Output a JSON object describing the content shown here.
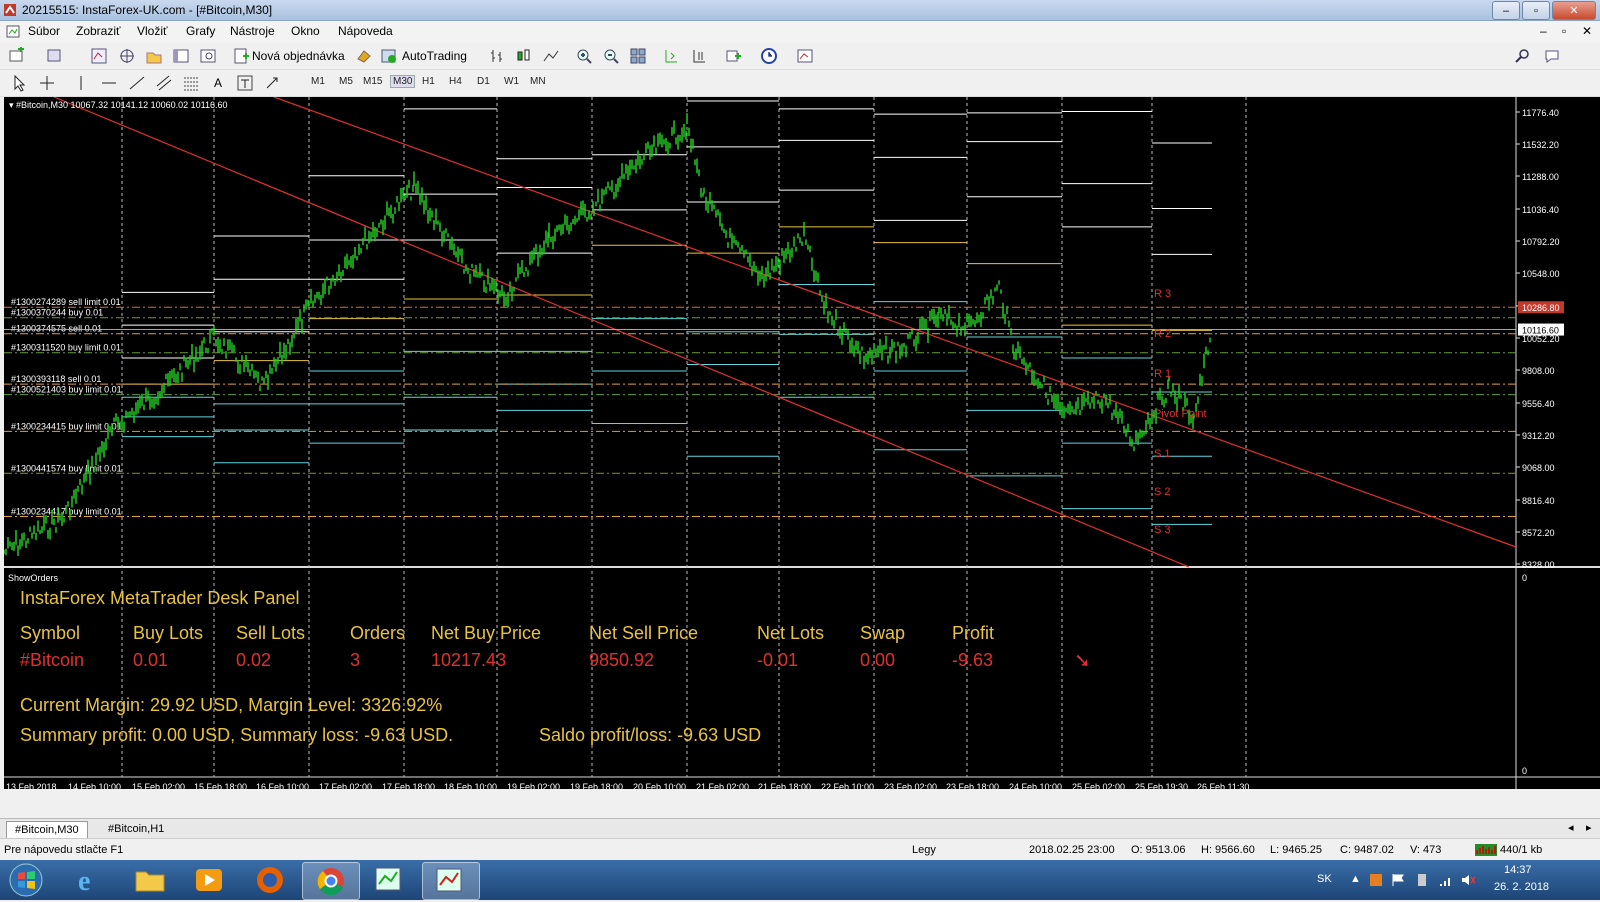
{
  "window": {
    "title": "20215515: InstaForex-UK.com - [#Bitcoin,M30]",
    "controls": [
      "–",
      "▫",
      "✕"
    ]
  },
  "menu": [
    "Súbor",
    "Zobraziť",
    "Vložiť",
    "Grafy",
    "Nástroje",
    "Okno",
    "Nápoveda"
  ],
  "toolbar": {
    "new_order_label": "Nová objednávka",
    "autotrading_label": "AutoTrading",
    "timeframes": [
      "M1",
      "M5",
      "M15",
      "M30",
      "H1",
      "H4",
      "D1",
      "W1",
      "MN"
    ],
    "active_timeframe": "M30"
  },
  "chart": {
    "header": "#Bitcoin,M30  10067.32 10141.12 10060.02 10116.60",
    "price_axis": [
      "11776.40",
      "11532.20",
      "11288.00",
      "11036.40",
      "10792.20",
      "10548.00",
      "10296.80",
      "10052.20",
      "9808.00",
      "9556.40",
      "9312.20",
      "9068.00",
      "8816.40",
      "8572.20",
      "8328.00"
    ],
    "current_price": "10116.60",
    "order_price": "10286.80",
    "orders": [
      {
        "label": "#1300274289 sell limit 0.01",
        "price": 10286.8
      },
      {
        "label": "#1300370244 buy 0.01",
        "price": 10207
      },
      {
        "label": "#1300374575 sell 0.01",
        "price": 10085
      },
      {
        "label": "#1300311520 buy limit 0.01",
        "price": 9940
      },
      {
        "label": "#1300393118 sell 0.01",
        "price": 9700
      },
      {
        "label": "#1300521403 buy limit 0.01",
        "price": 9620
      },
      {
        "label": "#1300234415 buy limit 0.01",
        "price": 9340
      },
      {
        "label": "#1300441574 buy limit 0.01",
        "price": 9020
      },
      {
        "label": "#1300234417 buy limit 0.01",
        "price": 8690
      }
    ],
    "pivot_labels": [
      "R 3",
      "R 2",
      "R 1",
      "Pivot Point",
      "S 1",
      "S 2",
      "S 3"
    ],
    "time_axis": [
      "13 Feb 2018",
      "14 Feb 10:00",
      "15 Feb 02:00",
      "15 Feb 18:00",
      "16 Feb 10:00",
      "17 Feb 02:00",
      "17 Feb 18:00",
      "18 Feb 10:00",
      "19 Feb 02:00",
      "19 Feb 18:00",
      "20 Feb 10:00",
      "21 Feb 02:00",
      "21 Feb 18:00",
      "22 Feb 10:00",
      "23 Feb 02:00",
      "23 Feb 18:00",
      "24 Feb 10:00",
      "25 Feb 02:00",
      "25 Feb 19:30",
      "26 Feb 11:30"
    ],
    "subwindow_label": "ShowOrders",
    "subwindow_axis": [
      "0",
      "0"
    ]
  },
  "panel": {
    "title": "InstaForex MetaTrader Desk Panel",
    "headers": [
      "Symbol",
      "Buy Lots",
      "Sell Lots",
      "Orders",
      "Net Buy Price",
      "Net Sell Price",
      "Net Lots",
      "Swap",
      "Profit"
    ],
    "row": [
      "#Bitcoin",
      "0.01",
      "0.02",
      "3",
      "10217.43",
      "9850.92",
      "-0.01",
      "0.00",
      "-9.63"
    ],
    "trend_arrow": "➘",
    "margin_line": "Current Margin: 29.92 USD, Margin Level: 3326.92%",
    "summary_line": "Summary profit: 0.00 USD, Summary loss: -9.63 USD.",
    "saldo_line": "Saldo profit/loss: -9.63 USD",
    "colors": {
      "header": "#e8c341",
      "value": "#e03030"
    }
  },
  "tabs": [
    "#Bitcoin,M30",
    "#Bitcoin,H1"
  ],
  "status": {
    "help": "Pre nápovedu stlačte F1",
    "profile": "Legy",
    "datetime": "2018.02.25 23:00",
    "open": "O: 9513.06",
    "high": "H: 9566.60",
    "low": "L: 9465.25",
    "close": "C: 9487.02",
    "volume": "V: 473",
    "traffic": "440/1 kb"
  },
  "taskbar": {
    "lang": "SK",
    "time": "14:37",
    "date": "26. 2. 2018"
  }
}
